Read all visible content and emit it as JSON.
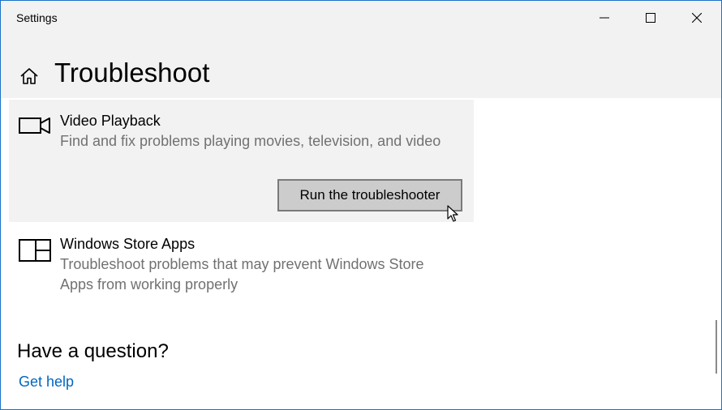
{
  "window": {
    "title": "Settings",
    "controls": {
      "minimize": "minimize-icon",
      "maximize": "maximize-icon",
      "close": "close-icon"
    }
  },
  "header": {
    "home_icon": "home-icon",
    "page_title": "Troubleshoot"
  },
  "troubleshooters": [
    {
      "icon": "video-camera-icon",
      "title": "Video Playback",
      "description": "Find and fix problems playing movies, television, and video",
      "button_label": "Run the troubleshooter",
      "selected": true
    },
    {
      "icon": "windows-store-apps-icon",
      "title": "Windows Store Apps",
      "description_lines": [
        "Troubleshoot problems that may prevent Windows Store",
        "Apps from working properly"
      ]
    }
  ],
  "help": {
    "heading": "Have a question?",
    "link": "Get help"
  },
  "colors": {
    "accent": "#0067c0",
    "titlebar_bg": "#f2f2f2",
    "selected_bg": "#f2f2f2",
    "description_text": "#717171",
    "button_bg": "#cccccc",
    "window_border": "#1a73c8"
  }
}
